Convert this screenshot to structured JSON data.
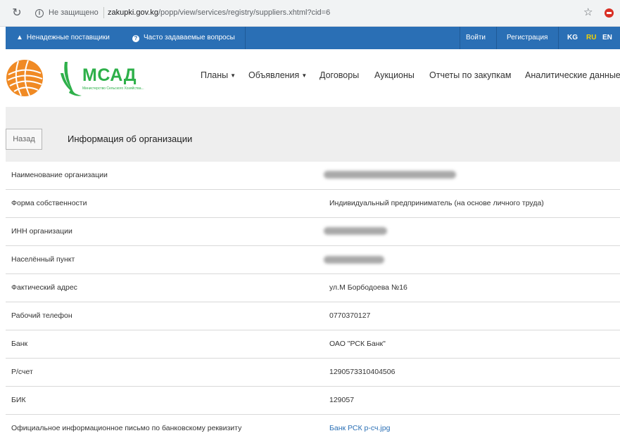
{
  "browser": {
    "insecure_label": "Не защищено",
    "url_domain": "zakupki.gov.kg",
    "url_path": "/popp/view/services/registry/suppliers.xhtml?cid=6",
    "reload_icon": "reload-icon",
    "star_icon": "star-icon",
    "extension_icon": "extension-icon"
  },
  "topnav": {
    "unreliable_suppliers": "Ненадежные поставщики",
    "faq": "Часто задаваемые вопросы",
    "login": "Войти",
    "register": "Регистрация",
    "languages": [
      "KG",
      "RU",
      "EN"
    ],
    "active_language": "RU",
    "accent_color": "#2a6fb5",
    "active_language_color": "#f5d200"
  },
  "logo": {
    "title": "МСАД",
    "subtitle": "Министерство Сельского Хозяйства..."
  },
  "mainmenu": {
    "plans": "Планы",
    "ads": "Объявления",
    "contracts": "Договоры",
    "auctions": "Аукционы",
    "reports": "Отчеты по закупкам",
    "analytics": "Аналитические данные"
  },
  "header": {
    "back_label": "Назад",
    "title": "Информация об организации"
  },
  "rows": [
    {
      "label": "Наименование организации",
      "value": ""
    },
    {
      "label": "Форма собственности",
      "value": "Индивидуальный предприниматель (на основе личного труда)"
    },
    {
      "label": "ИНН организации",
      "value": ""
    },
    {
      "label": "Населённый пункт",
      "value": ""
    },
    {
      "label": "Фактический адрес",
      "value": "ул.М Борбодоева №16"
    },
    {
      "label": "Рабочий телефон",
      "value": "0770370127"
    },
    {
      "label": "Банк",
      "value": "ОАО \"РСК Банк\""
    },
    {
      "label": "Р/счет",
      "value": "1290573310404506"
    },
    {
      "label": "БИК",
      "value": "129057"
    },
    {
      "label": "Официальное информационное письмо по банковскому реквизиту",
      "value": "Банк РСК р-сч.jpg"
    }
  ]
}
